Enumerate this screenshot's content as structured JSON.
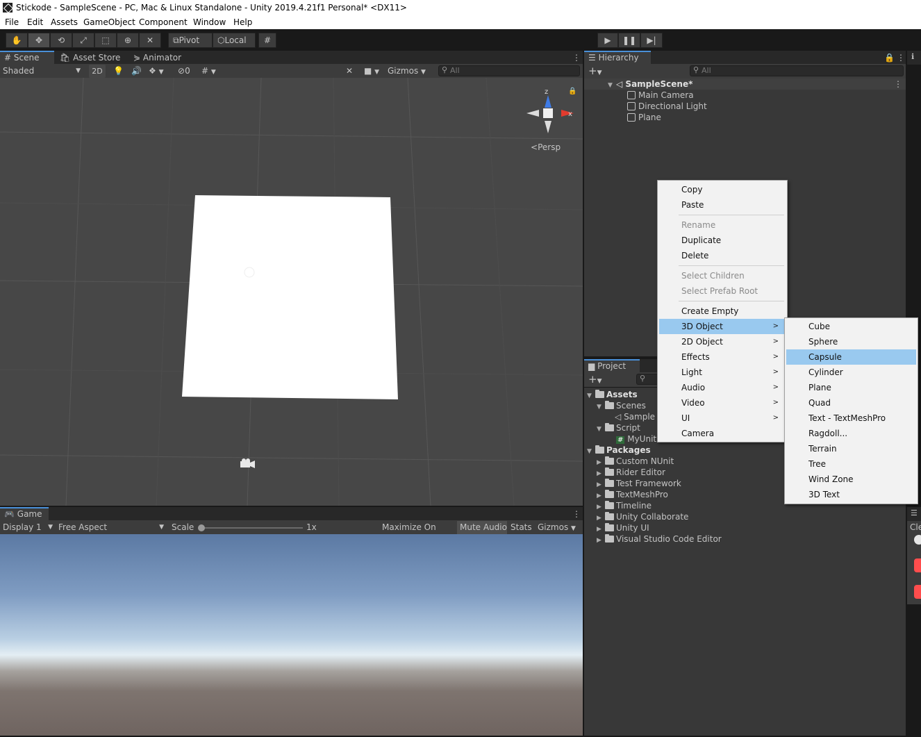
{
  "window": {
    "title": "Stickode - SampleScene - PC, Mac & Linux Standalone - Unity 2019.4.21f1 Personal* <DX11>"
  },
  "menubar": [
    "File",
    "Edit",
    "Assets",
    "GameObject",
    "Component",
    "Window",
    "Help"
  ],
  "toolbar": {
    "pivot_label": "Pivot",
    "local_label": "Local"
  },
  "scene_tabs": {
    "scene": "Scene",
    "asset_store": "Asset Store",
    "animator": "Animator"
  },
  "scene_controls": {
    "shading": "Shaded",
    "mode_2d": "2D",
    "hidden_count": "0",
    "gizmos": "Gizmos",
    "search_placeholder": "All",
    "persp": "Persp",
    "axis_z": "z",
    "axis_x": "x"
  },
  "game": {
    "tab": "Game",
    "display": "Display 1",
    "aspect": "Free Aspect",
    "scale_label": "Scale",
    "scale_value": "1x",
    "maximize": "Maximize On Play",
    "mute": "Mute Audio",
    "stats": "Stats",
    "gizmos": "Gizmos"
  },
  "hierarchy": {
    "tab": "Hierarchy",
    "search_placeholder": "All",
    "scene": "SampleScene*",
    "items": [
      "Main Camera",
      "Directional Light",
      "Plane"
    ]
  },
  "project": {
    "tab": "Project",
    "assets": "Assets",
    "scenes_folder": "Scenes",
    "scene_file": "Sample",
    "script_folder": "Script",
    "script_file": "MyUnit",
    "packages": "Packages",
    "package_items": [
      "Custom NUnit",
      "Rider Editor",
      "Test Framework",
      "TextMeshPro",
      "Timeline",
      "Unity Collaborate",
      "Unity UI",
      "Visual Studio Code Editor"
    ]
  },
  "inspector_stub": {
    "label": "Cle"
  },
  "context_menu": {
    "copy": "Copy",
    "paste": "Paste",
    "rename": "Rename",
    "duplicate": "Duplicate",
    "delete": "Delete",
    "select_children": "Select Children",
    "select_prefab_root": "Select Prefab Root",
    "create_empty": "Create Empty",
    "object_3d": "3D Object",
    "object_2d": "2D Object",
    "effects": "Effects",
    "light": "Light",
    "audio": "Audio",
    "video": "Video",
    "ui": "UI",
    "camera": "Camera"
  },
  "submenu_3d": [
    "Cube",
    "Sphere",
    "Capsule",
    "Cylinder",
    "Plane",
    "Quad",
    "Text - TextMeshPro",
    "Ragdoll...",
    "Terrain",
    "Tree",
    "Wind Zone",
    "3D Text"
  ],
  "colors": {
    "highlight": "#99c9ef",
    "selected_tab": "#4a90d9"
  }
}
